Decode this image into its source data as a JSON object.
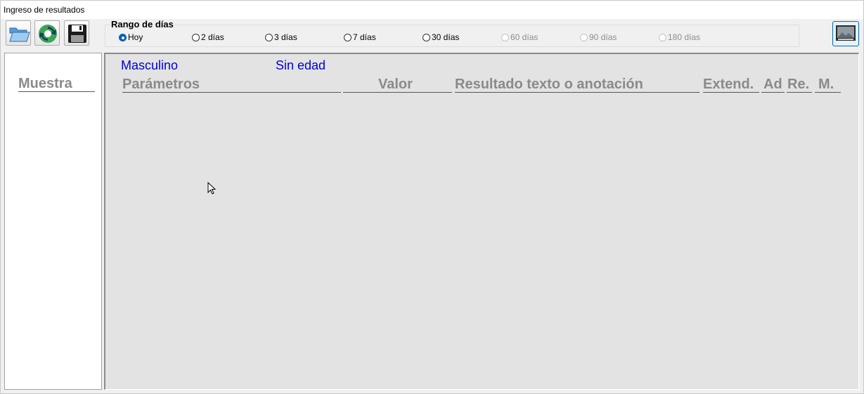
{
  "window": {
    "title": "Ingreso de resultados"
  },
  "toolbar": {
    "buttons": [
      {
        "name": "open",
        "icon": "folder-open-icon"
      },
      {
        "name": "refresh",
        "icon": "refresh-icon"
      },
      {
        "name": "save",
        "icon": "floppy-disk-icon"
      }
    ],
    "screen_button_icon": "monitor-icon"
  },
  "day_range": {
    "legend": "Rango de días",
    "options": [
      {
        "label": "Hoy",
        "checked": true,
        "enabled": true
      },
      {
        "label": "2 días",
        "checked": false,
        "enabled": true
      },
      {
        "label": "3 días",
        "checked": false,
        "enabled": true
      },
      {
        "label": "7 días",
        "checked": false,
        "enabled": true
      },
      {
        "label": "30 días",
        "checked": false,
        "enabled": true
      },
      {
        "label": "60 días",
        "checked": false,
        "enabled": false
      },
      {
        "label": "90 días",
        "checked": false,
        "enabled": false
      },
      {
        "label": "180 días",
        "checked": false,
        "enabled": false
      }
    ]
  },
  "sample_panel": {
    "header": "Muestra"
  },
  "patient": {
    "sex": "Masculino",
    "age": "Sin edad"
  },
  "results_table": {
    "columns": [
      "Parámetros",
      "Valor",
      "Resultado texto o anotación",
      "Extend.",
      "Ad",
      "Re.",
      "M."
    ]
  },
  "colors": {
    "accent": "#005fb8",
    "label_blue": "#0000d8",
    "header_gray": "#8a8a8a",
    "panel_bg": "#e3e3e3"
  }
}
